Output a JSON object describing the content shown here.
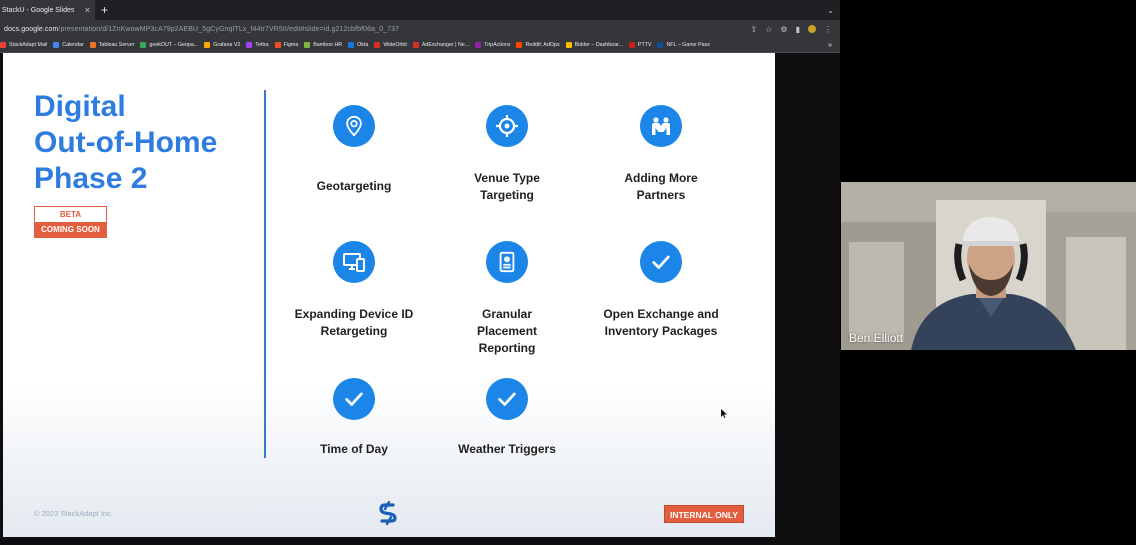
{
  "browser": {
    "tab_title": "StackU - Google Slides",
    "tab_close": "×",
    "new_tab": "+",
    "url_host": "docs.google.com",
    "url_path": "/presentation/d/1ZnKwowMP3cA79p2AEBU_5gCyGnqITLx_f44tr7VR5tI/edit#slide=id.g212cbfbf06a_0_737",
    "bookmarks": [
      "StackAdapt Mail",
      "Calendar",
      "Tableau Server",
      "geekOUT – Geopa...",
      "Grafana V2",
      "Tettra",
      "Figma",
      "Bamboo HR",
      "Okta",
      "WideOrbit",
      "AdExchanger | Ne...",
      "TripActions",
      "Reddit: AdOps",
      "Bidder – Dashboar...",
      "PTTV",
      "NFL – Game Pass"
    ],
    "bookmark_colors": [
      "#ea4335",
      "#4285f4",
      "#e97627",
      "#34a853",
      "#f9ab00",
      "#a142f4",
      "#f24e1e",
      "#7cb342",
      "#1a73e8",
      "#d93025",
      "#d93025",
      "#8e24aa",
      "#ff4500",
      "#fbbc04",
      "#c5221f",
      "#0f4c97"
    ],
    "more_bookmarks": "»"
  },
  "slide": {
    "title_lines": [
      "Digital",
      "Out-of-Home",
      "Phase 2"
    ],
    "beta": "BETA",
    "coming_soon": "COMING SOON",
    "features": [
      {
        "label": "Geotargeting",
        "icon": "location-pin-icon"
      },
      {
        "label": "Venue Type Targeting",
        "icon": "target-icon"
      },
      {
        "label": "Adding More Partners",
        "icon": "partners-icon"
      },
      {
        "label": "Expanding Device ID Retargeting",
        "icon": "devices-icon"
      },
      {
        "label": "Granular Placement Reporting",
        "icon": "report-icon"
      },
      {
        "label": "Open Exchange and Inventory Packages",
        "icon": "checkmark-icon"
      },
      {
        "label": "Time of Day",
        "icon": "checkmark-icon"
      },
      {
        "label": "Weather Triggers",
        "icon": "checkmark-icon"
      }
    ],
    "copyright": "© 2023 StackAdapt Inc.",
    "internal_only": "INTERNAL ONLY"
  },
  "video": {
    "participant_name": "Ben Elliott"
  },
  "colors": {
    "accent_blue": "#1b86e8",
    "title_blue": "#2f7ce0",
    "coming_soon_orange": "#e35d3f"
  }
}
